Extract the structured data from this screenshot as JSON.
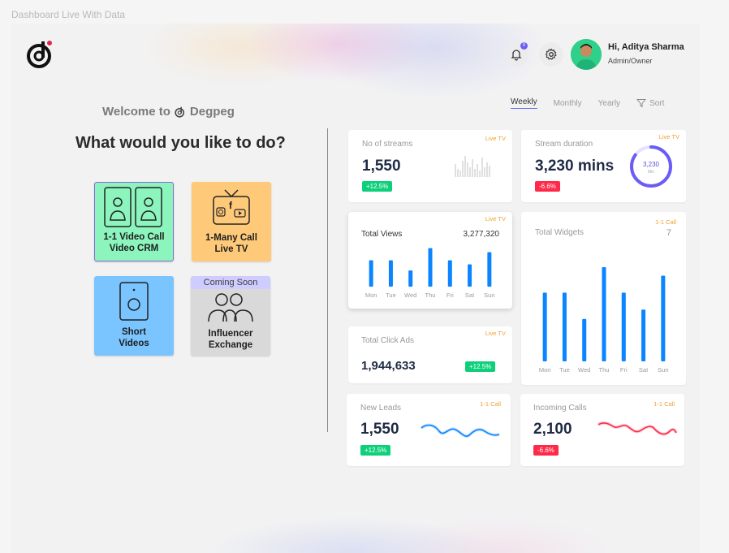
{
  "frame_title": "Dashboard Live With Data",
  "header": {
    "notification_count": "0",
    "user_name": "Hi, Aditya Sharma",
    "user_role": "Admin/Owner"
  },
  "welcome": {
    "prefix": "Welcome to",
    "brand": "Degpeg",
    "question": "What would you like to do?"
  },
  "tiles": [
    {
      "label_line1": "1-1 Video Call",
      "label_line2": "Video CRM",
      "color": "#8cf4bd"
    },
    {
      "label_line1": "1-Many Call",
      "label_line2": "Live TV",
      "color": "#ffc97a"
    },
    {
      "label_line1": "Short",
      "label_line2": "Videos",
      "color": "#7ac4ff"
    },
    {
      "label_line1": "Influencer",
      "label_line2": "Exchange",
      "badge": "Coming Soon",
      "color": "#d9d9d9"
    }
  ],
  "filters": {
    "tabs": [
      "Weekly",
      "Monthly",
      "Yearly"
    ],
    "active": "Weekly",
    "sort_label": "Sort"
  },
  "cards": {
    "streams": {
      "title": "No of streams",
      "tag": "Live TV",
      "value": "1,550",
      "change": "+12.5%"
    },
    "duration": {
      "title": "Stream duration",
      "tag": "Live TV",
      "value": "3,230 mins",
      "ring_value": "3,230",
      "ring_unit": "Min",
      "change": "-6.6%",
      "ring_fraction": 0.85
    },
    "views": {
      "title": "Total Views",
      "tag": "Live TV",
      "total": "3,277,320",
      "days": [
        "Mon",
        "Tue",
        "Wed",
        "Thu",
        "Fri",
        "Sat",
        "Sun"
      ],
      "bars": [
        0.65,
        0.65,
        0.4,
        0.95,
        0.65,
        0.55,
        0.85
      ]
    },
    "widgets": {
      "title": "Total Widgets",
      "tag": "1-1 Call",
      "count": "7",
      "days": [
        "Mon",
        "Tue",
        "Wed",
        "Thu",
        "Fri",
        "Sat",
        "Sun"
      ],
      "bars": [
        0.73,
        0.73,
        0.45,
        1.0,
        0.73,
        0.55,
        0.91
      ]
    },
    "click_ads": {
      "title": "Total Click Ads",
      "tag": "Live TV",
      "value": "1,944,633",
      "change": "+12.5%"
    },
    "leads": {
      "title": "New Leads",
      "tag": "1-1 Call",
      "value": "1,550",
      "change": "+12.5%"
    },
    "calls": {
      "title": "Incoming Calls",
      "tag": "1-1 Call",
      "value": "2,100",
      "change": "-6.6%"
    }
  },
  "colors": {
    "accent": "#0a84ff",
    "green": "#0fd07a",
    "red": "#ff2a4a",
    "tag": "#f0a030",
    "ring": "#6b5cf6"
  }
}
